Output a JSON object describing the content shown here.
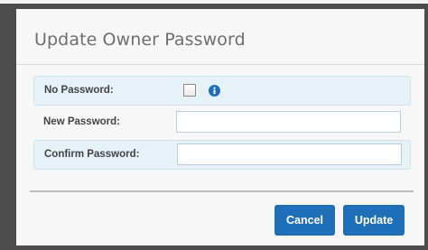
{
  "dialog": {
    "title": "Update Owner Password"
  },
  "fields": {
    "no_password": {
      "label": "No Password:",
      "checked": false,
      "info_icon": "info-circle-icon"
    },
    "new_password": {
      "label": "New Password:",
      "value": ""
    },
    "confirm_password": {
      "label": "Confirm Password:",
      "value": ""
    }
  },
  "buttons": {
    "cancel_label": "Cancel",
    "update_label": "Update"
  },
  "colors": {
    "accent": "#1e6fb7",
    "row_highlight": "#e6f1f8"
  }
}
